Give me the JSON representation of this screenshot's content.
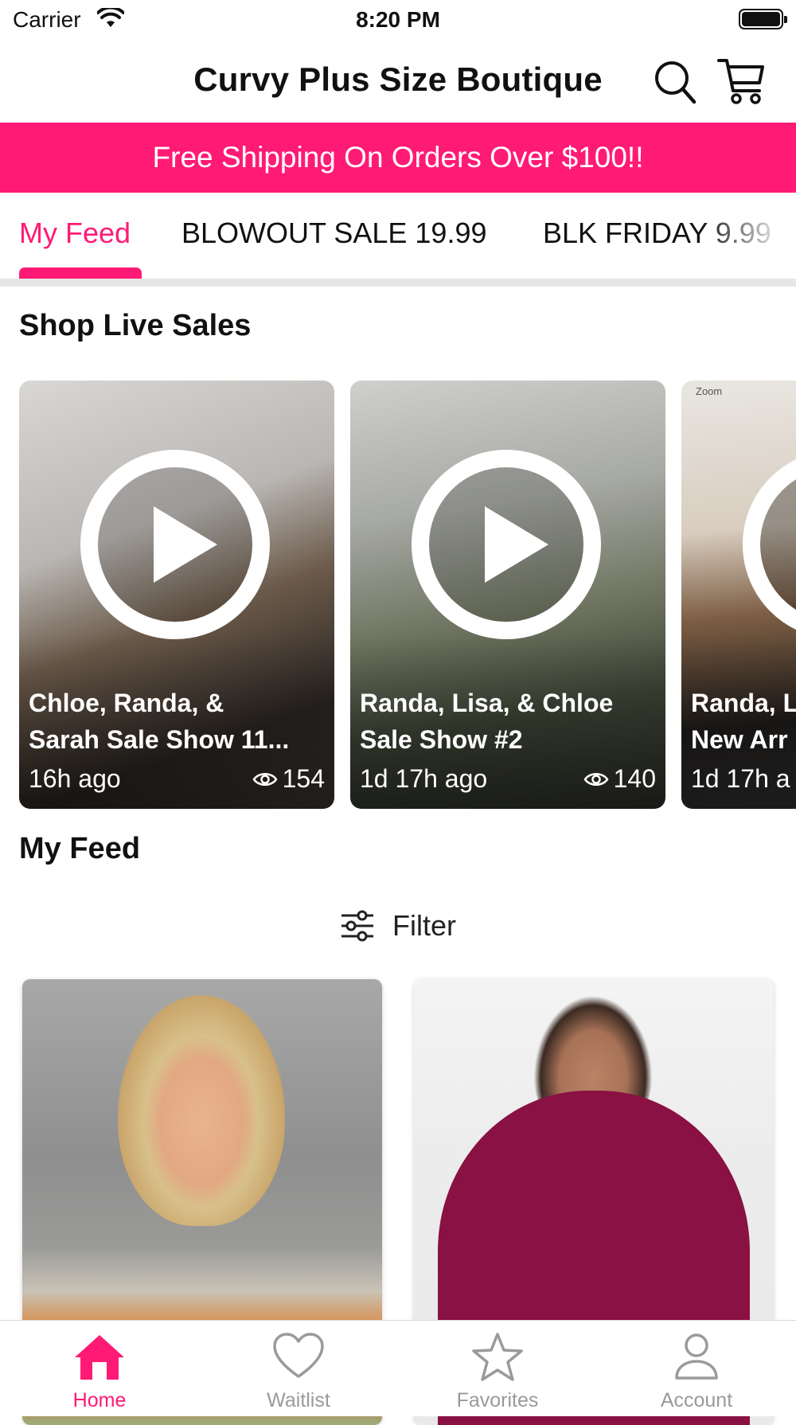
{
  "status_bar": {
    "carrier": "Carrier",
    "time": "8:20 PM"
  },
  "header": {
    "title": "Curvy Plus Size Boutique",
    "search_icon": "search-icon",
    "cart_icon": "cart-icon"
  },
  "banner": {
    "text": "Free Shipping On Orders Over $100!!",
    "color": "#ff1a75"
  },
  "tabs": [
    {
      "label": "My Feed",
      "active": true
    },
    {
      "label": "BLOWOUT SALE 19.99",
      "active": false
    },
    {
      "label": "BLK FRIDAY 9.99",
      "active": false
    }
  ],
  "live_sales": {
    "title": "Shop Live Sales",
    "cards": [
      {
        "title_line1": "Chloe, Randa, &",
        "title_line2": "Sarah Sale Show 11...",
        "ago": "16h ago",
        "views": "154"
      },
      {
        "title_line1": "Randa, Lisa, & Chloe",
        "title_line2": "Sale Show #2",
        "ago": "1d 17h ago",
        "views": "140"
      },
      {
        "title_line1": "Randa, L",
        "title_line2": "New Arr",
        "ago": "1d 17h a",
        "views": "",
        "watermark": "Zoom"
      }
    ]
  },
  "feed": {
    "title": "My Feed",
    "filter_label": "Filter"
  },
  "tabbar": [
    {
      "label": "Home",
      "icon": "home-icon",
      "active": true
    },
    {
      "label": "Waitlist",
      "icon": "heart-icon",
      "active": false
    },
    {
      "label": "Favorites",
      "icon": "star-icon",
      "active": false
    },
    {
      "label": "Account",
      "icon": "person-icon",
      "active": false
    }
  ],
  "colors": {
    "accent": "#ff1a75",
    "inactive": "#9a9a9a"
  }
}
